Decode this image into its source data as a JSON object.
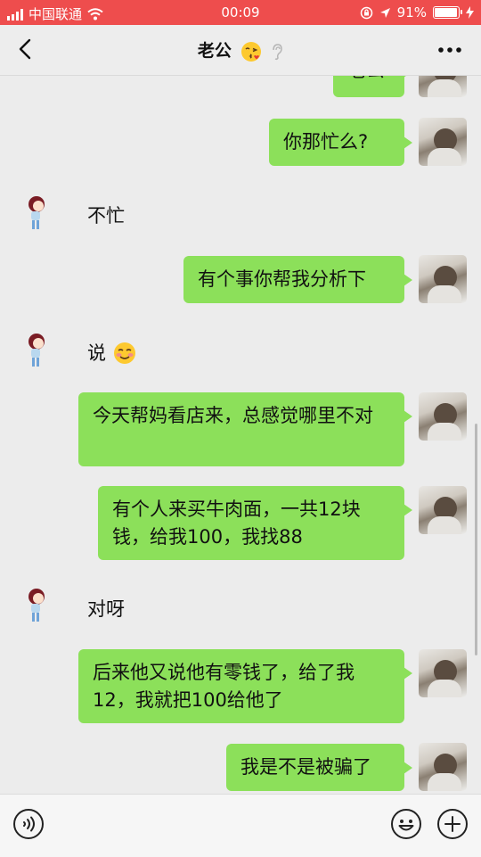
{
  "status_bar": {
    "carrier": "中国联通",
    "time": "00:09",
    "battery_percent": "91%",
    "battery_level": 0.91
  },
  "nav": {
    "title": "老公"
  },
  "messages": [
    {
      "side": "me",
      "text": "老公"
    },
    {
      "side": "me",
      "text": "你那忙么?"
    },
    {
      "side": "them",
      "text": "不忙"
    },
    {
      "side": "me",
      "text": "有个事你帮我分析下"
    },
    {
      "side": "them",
      "text": "说"
    },
    {
      "side": "me",
      "text": "今天帮妈看店来，总感觉哪里不对"
    },
    {
      "side": "me",
      "text": "有个人来买牛肉面，一共12块钱，给我100，我找88"
    },
    {
      "side": "them",
      "text": "对呀"
    },
    {
      "side": "me",
      "text": "后来他又说他有零钱了，给了我12，我就把100给他了"
    },
    {
      "side": "me",
      "text": "我是不是被骗了"
    }
  ],
  "icons": {
    "back": "chevron-left-icon",
    "more": "more-icon",
    "voice": "voice-icon",
    "emoji": "emoji-icon",
    "add": "plus-icon"
  },
  "colors": {
    "status_bar": "#ee4d4d",
    "bubble_me": "#8ce05a",
    "background": "#ececec"
  }
}
